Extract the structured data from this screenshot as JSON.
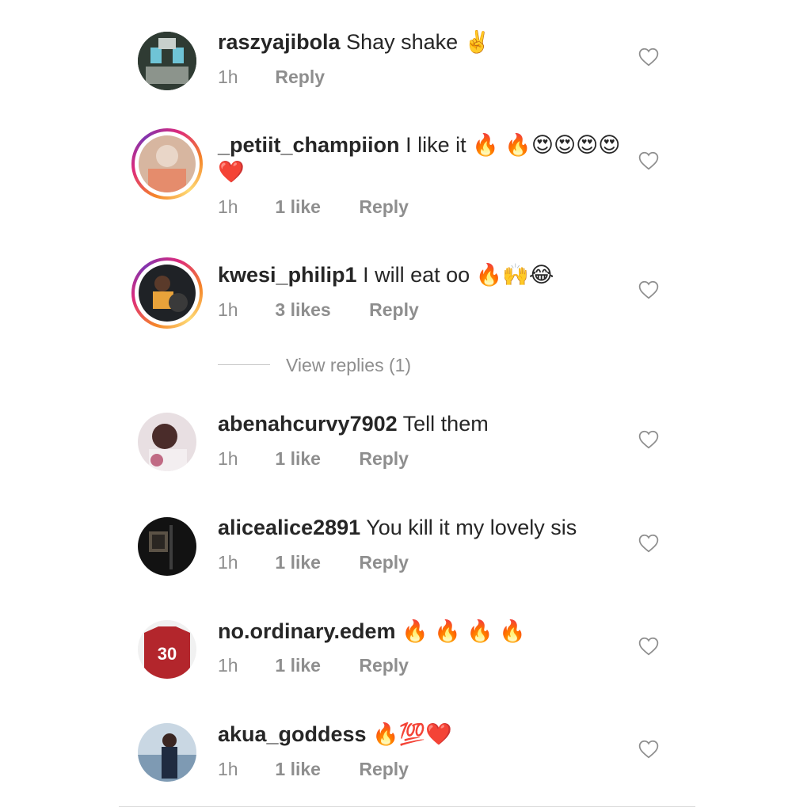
{
  "comments": [
    {
      "username": "raszyajibola",
      "text": "Shay shake ✌️",
      "time": "1h",
      "likes": "",
      "reply_label": "Reply",
      "story_ring": false,
      "avatar_color": "#3a4a3a"
    },
    {
      "username": "_petiit_champiion",
      "text": "I like it 🔥 🔥😍😍😍😍❤️",
      "time": "1h",
      "likes": "1 like",
      "reply_label": "Reply",
      "story_ring": true,
      "avatar_color": "#c9a18a"
    },
    {
      "username": "kwesi_philip1",
      "text": "I will eat oo 🔥🙌😂",
      "time": "1h",
      "likes": "3 likes",
      "reply_label": "Reply",
      "story_ring": true,
      "avatar_color": "#2b2b2b"
    },
    {
      "username": "abenahcurvy7902",
      "text": "Tell them",
      "time": "1h",
      "likes": "1 like",
      "reply_label": "Reply",
      "story_ring": false,
      "avatar_color": "#b87d8a"
    },
    {
      "username": "alicealice2891",
      "text": "You kill it my lovely sis",
      "time": "1h",
      "likes": "1 like",
      "reply_label": "Reply",
      "story_ring": false,
      "avatar_color": "#1c1c1c"
    },
    {
      "username": "no.ordinary.edem",
      "text": "🔥 🔥 🔥 🔥",
      "time": "1h",
      "likes": "1 like",
      "reply_label": "Reply",
      "story_ring": false,
      "avatar_color": "#b3262c",
      "avatar_jersey_number": "30"
    },
    {
      "username": "akua_goddess",
      "text": "🔥💯❤️",
      "time": "1h",
      "likes": "1 like",
      "reply_label": "Reply",
      "story_ring": false,
      "avatar_color": "#6a8aa5"
    }
  ],
  "view_replies": {
    "label": "View replies (1)"
  },
  "icons": {
    "like": "heart-outline-icon"
  },
  "colors": {
    "text": "#262626",
    "secondary": "#8e8e8e",
    "ring_start": "#f58529",
    "ring_end": "#dd2a7b"
  }
}
